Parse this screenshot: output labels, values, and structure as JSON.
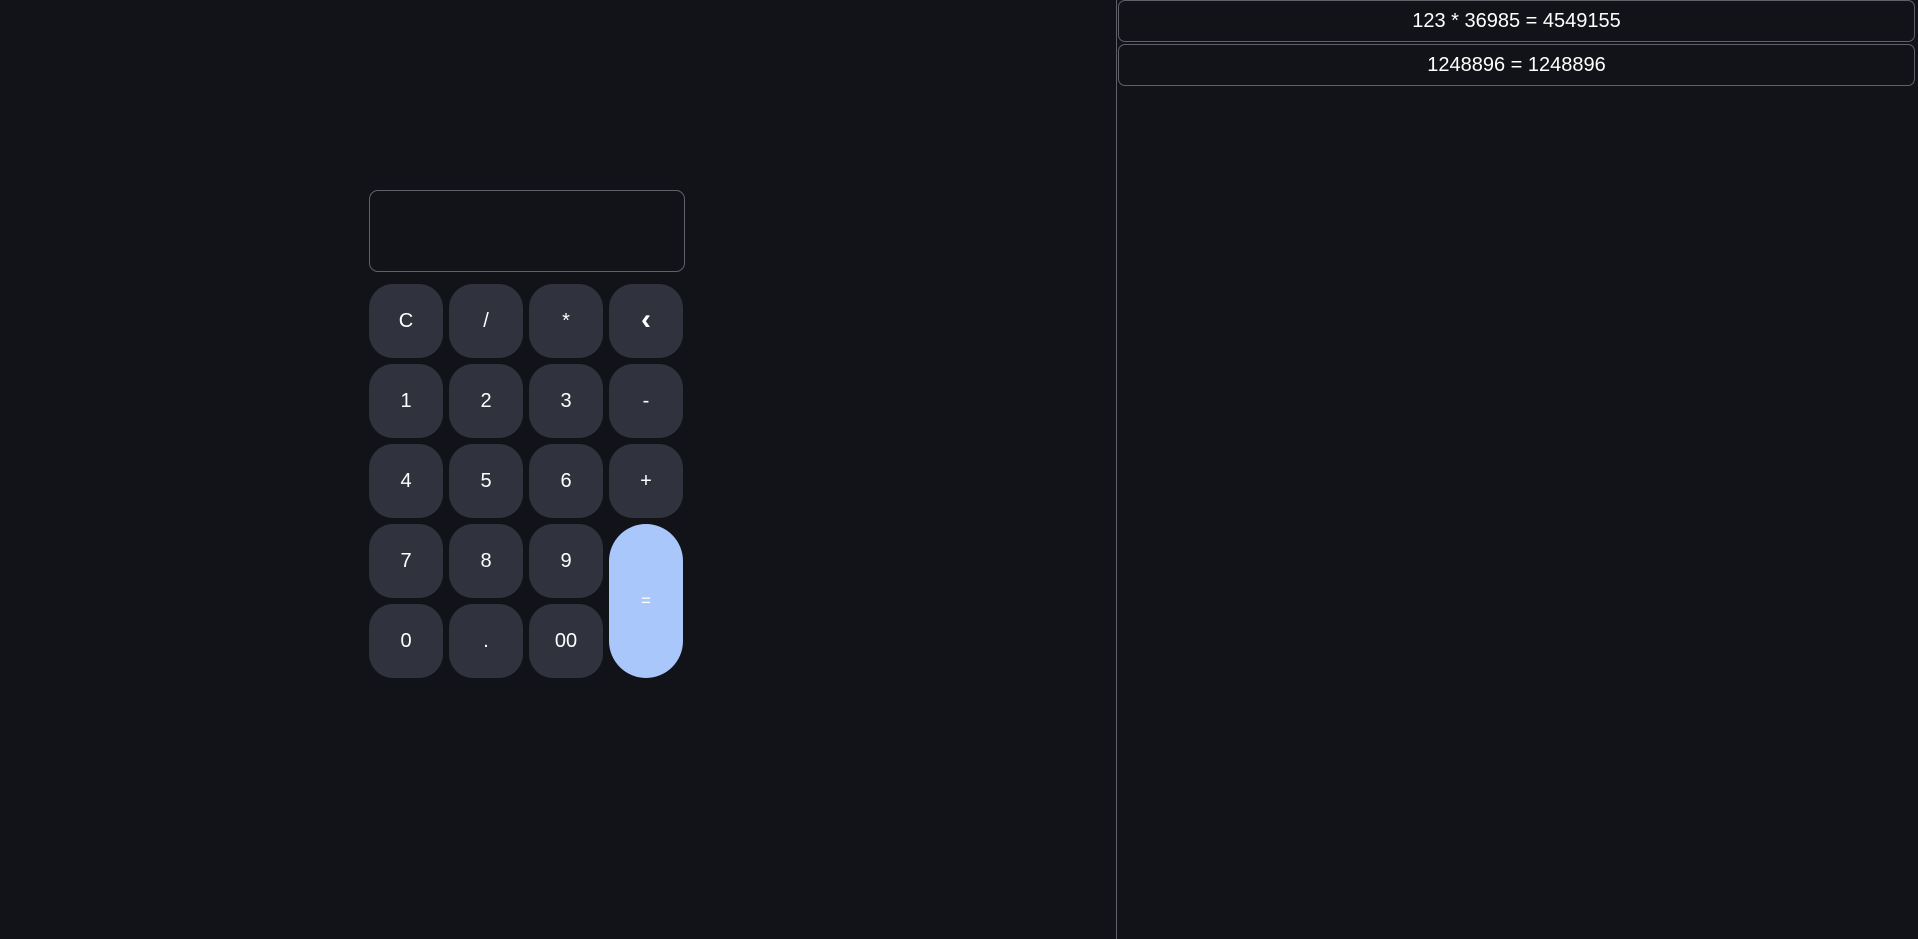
{
  "calculator": {
    "display_value": "",
    "keys": {
      "clear": "C",
      "divide": "/",
      "multiply": "*",
      "backspace": "‹",
      "one": "1",
      "two": "2",
      "three": "3",
      "minus": "-",
      "four": "4",
      "five": "5",
      "six": "6",
      "plus": "+",
      "seven": "7",
      "eight": "8",
      "nine": "9",
      "equals": "=",
      "zero": "0",
      "decimal": ".",
      "double_zero": "00"
    }
  },
  "history": {
    "items": [
      {
        "text": "123 * 36985 = 4549155"
      },
      {
        "text": "1248896 = 1248896"
      }
    ]
  },
  "colors": {
    "background": "#111318",
    "key": "#30323d",
    "accent": "#aac7fc",
    "border": "#5f6168",
    "text": "#ffffff"
  }
}
